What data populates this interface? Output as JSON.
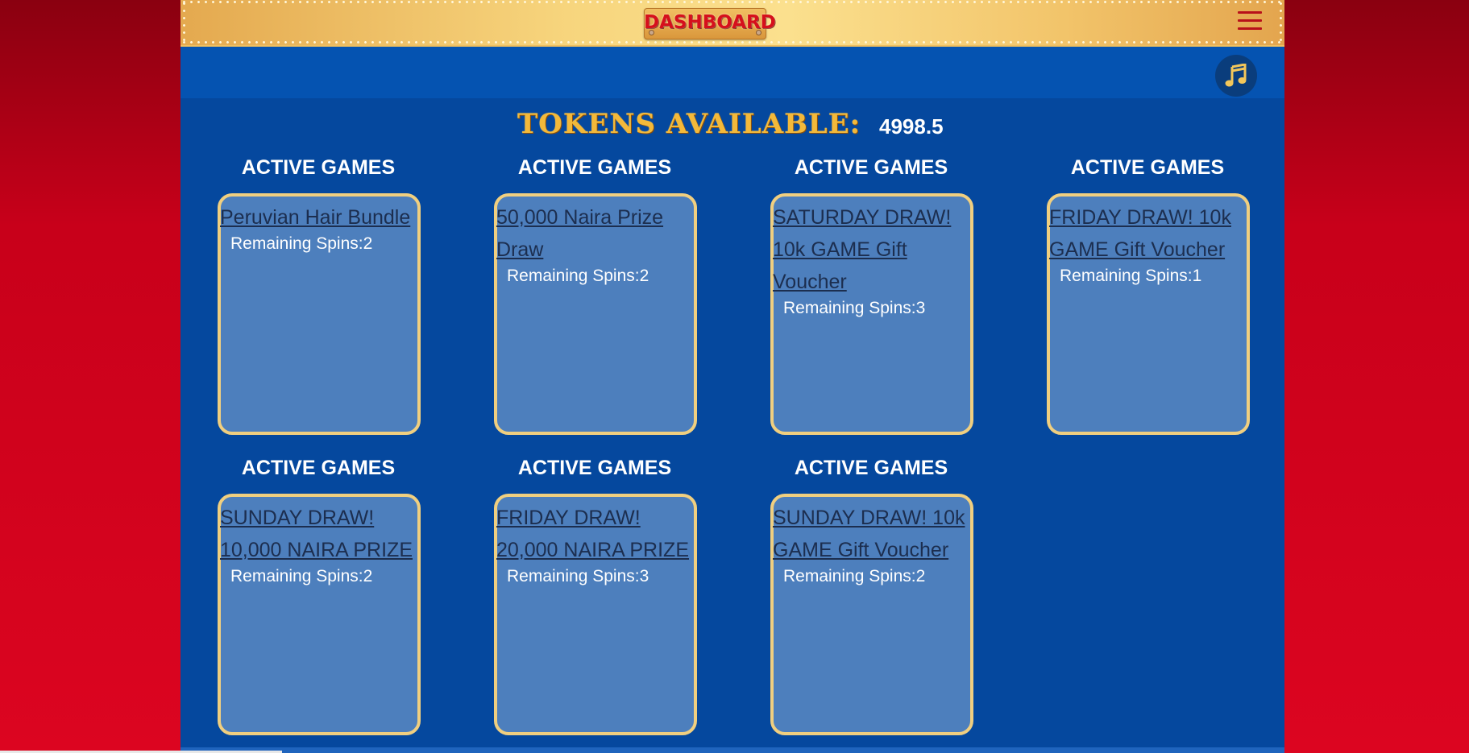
{
  "header": {
    "title": "DASHBOARD",
    "menu_icon": "hamburger-menu-icon"
  },
  "music": {
    "icon": "music-note-icon"
  },
  "tokens": {
    "label": "TOKENS AVAILABLE:",
    "value": "4998.5"
  },
  "games": [
    {
      "section_title": "ACTIVE GAMES",
      "name": "Peruvian Hair Bundle",
      "spins": "Remaining Spins:2"
    },
    {
      "section_title": "ACTIVE GAMES",
      "name": "50,000 Naira Prize Draw",
      "spins": "Remaining Spins:2"
    },
    {
      "section_title": "ACTIVE GAMES",
      "name": "SATURDAY DRAW! 10k GAME Gift Voucher",
      "spins": "Remaining Spins:3"
    },
    {
      "section_title": "ACTIVE GAMES",
      "name": "FRIDAY DRAW! 10k GAME Gift Voucher",
      "spins": "Remaining Spins:1"
    },
    {
      "section_title": "ACTIVE GAMES",
      "name": "SUNDAY DRAW! 10,000 NAIRA PRIZE",
      "spins": "Remaining Spins:2"
    },
    {
      "section_title": "ACTIVE GAMES",
      "name": "FRIDAY DRAW! 20,000 NAIRA PRIZE",
      "spins": "Remaining Spins:3"
    },
    {
      "section_title": "ACTIVE GAMES",
      "name": "SUNDAY DRAW! 10k GAME Gift Voucher",
      "spins": "Remaining Spins:2"
    }
  ],
  "colors": {
    "page_bg": "#dc0520",
    "panel_bg": "#05489e",
    "card_bg": "#4d7fbd",
    "card_border": "#f0cf80",
    "header_gold": "#f7d57d",
    "title_red": "#d6101c"
  }
}
